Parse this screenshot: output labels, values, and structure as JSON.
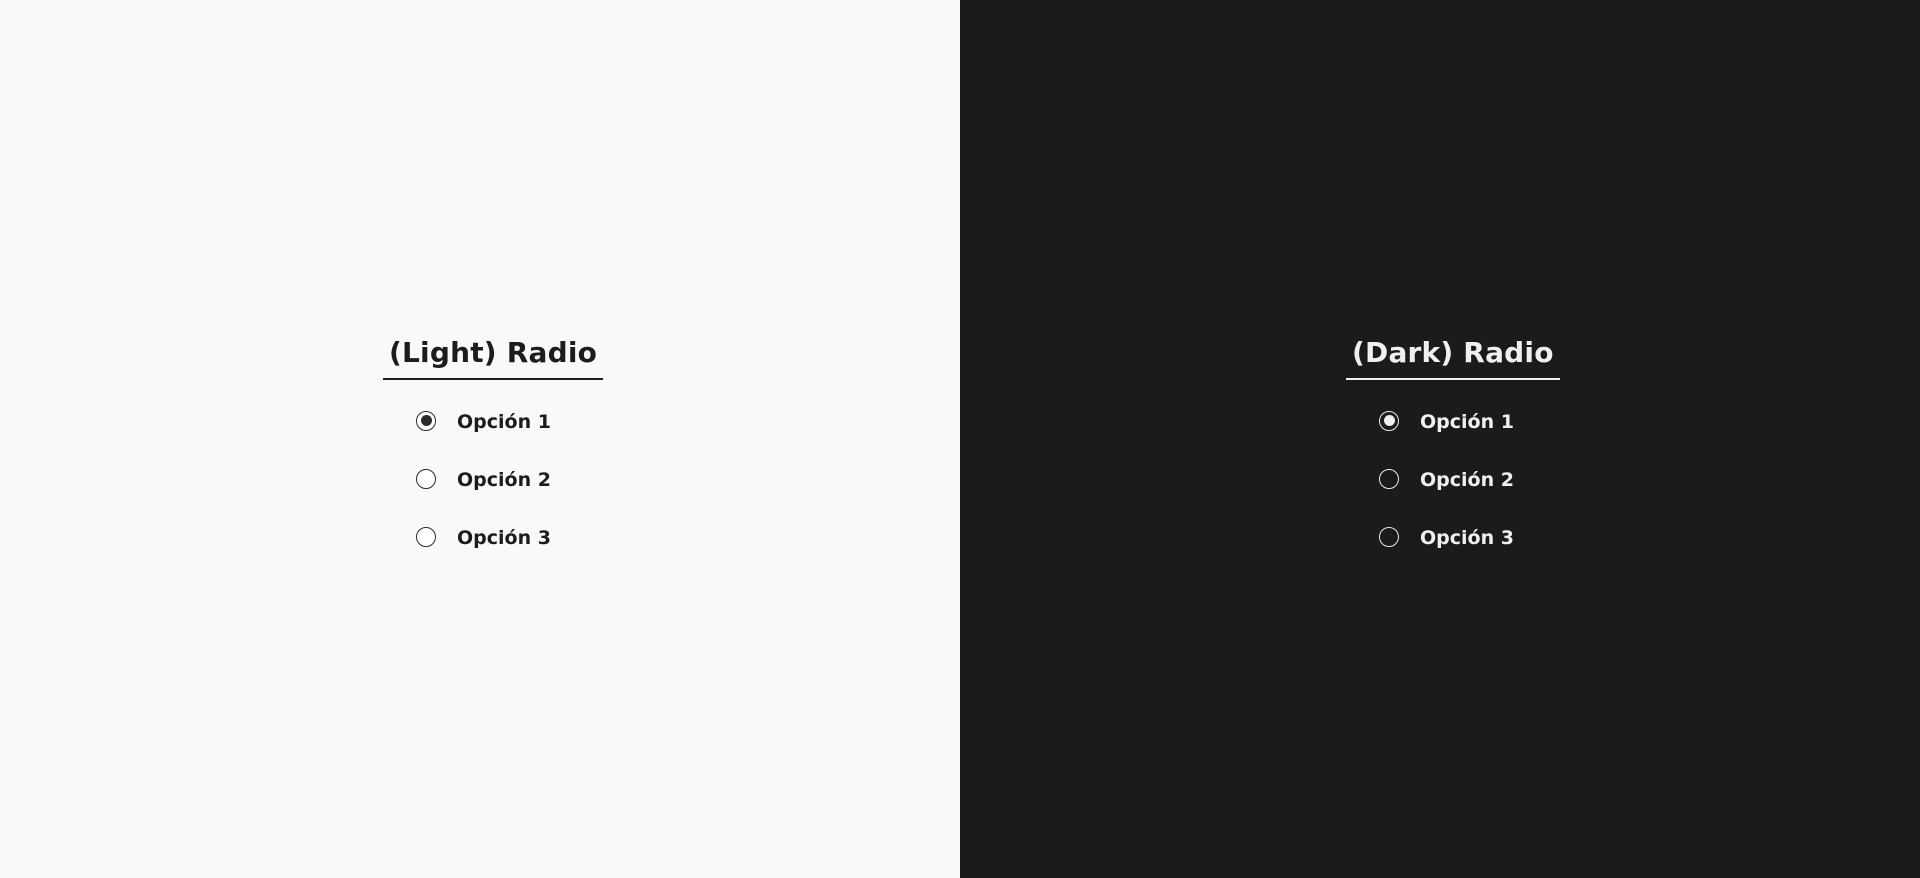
{
  "colors": {
    "light_background": "#f9f9f9",
    "light_text": "#1c1c1c",
    "dark_background": "#1b1b1b",
    "dark_text": "#f0f0f0"
  },
  "light": {
    "title": "(Light) Radio",
    "options": [
      {
        "label": "Opción 1",
        "selected": true
      },
      {
        "label": "Opción 2",
        "selected": false
      },
      {
        "label": "Opción 3",
        "selected": false
      }
    ]
  },
  "dark": {
    "title": "(Dark) Radio",
    "options": [
      {
        "label": "Opción 1",
        "selected": true
      },
      {
        "label": "Opción 2",
        "selected": false
      },
      {
        "label": "Opción 3",
        "selected": false
      }
    ]
  }
}
